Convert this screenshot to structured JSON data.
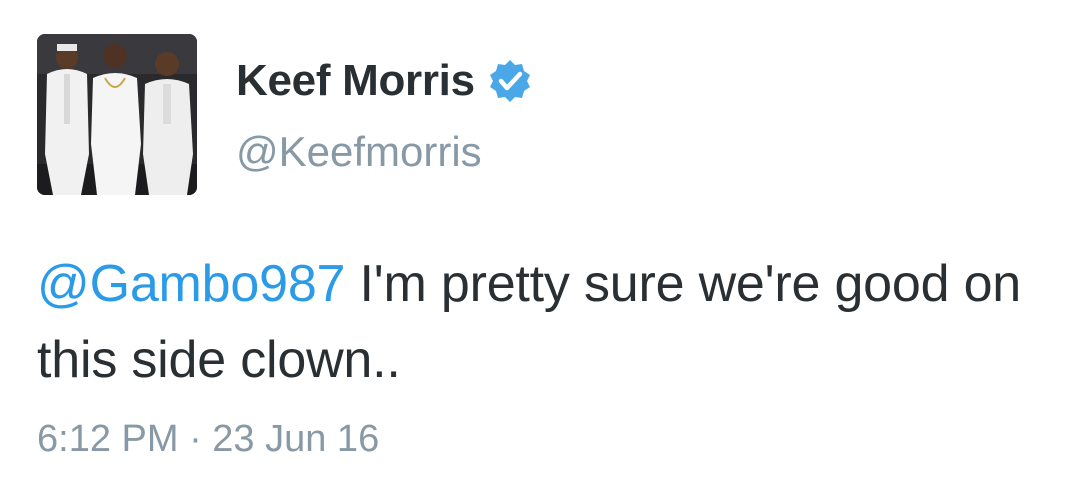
{
  "tweet": {
    "author": {
      "display_name": "Keef Morris",
      "handle": "@Keefmorris",
      "verified": true,
      "verified_icon": "verified-badge-icon"
    },
    "body": {
      "mention": "@Gambo987",
      "text": " I'm pretty sure we're good on this side clown.."
    },
    "timestamp": "6:12 PM · 23 Jun 16"
  },
  "colors": {
    "text": "#292f33",
    "secondary": "#8899a6",
    "link": "#2b9be8",
    "verified": "#4aa7e8"
  }
}
